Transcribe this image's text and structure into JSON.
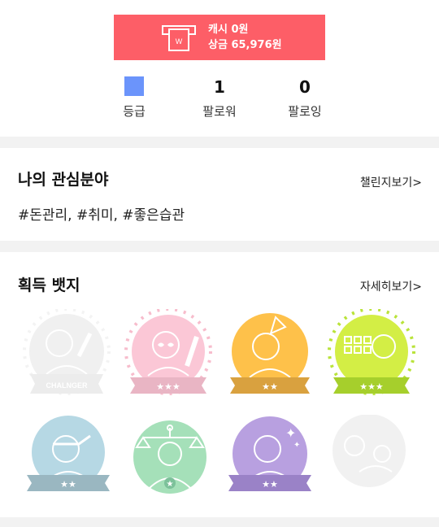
{
  "cash": {
    "cash_text": "캐시 0원",
    "prize_text": "상금 65,976원",
    "icon": "wallet-icon",
    "color": "#fd5e67"
  },
  "stats": {
    "grade": {
      "label": "등급",
      "color": "#6b94fb"
    },
    "followers": {
      "value": "1",
      "label": "팔로워"
    },
    "following": {
      "value": "0",
      "label": "팔로잉"
    }
  },
  "interests": {
    "title": "나의 관심분야",
    "link": "챌린지보기>",
    "tags": "#돈관리, #취미, #좋은습관"
  },
  "badges": {
    "title": "획득 뱃지",
    "link": "자세히보기>",
    "items": [
      {
        "name": "challenger-badge",
        "ribbon_text": "CHALNGER",
        "stars": 0,
        "earned": false
      },
      {
        "name": "pink-heart-glasses-badge",
        "stars": 3,
        "earned": true
      },
      {
        "name": "yellow-flag-badge",
        "stars": 2,
        "earned": true
      },
      {
        "name": "lime-checklist-badge",
        "stars": 3,
        "earned": true
      },
      {
        "name": "blue-headband-badge",
        "stars": 2,
        "earned": true
      },
      {
        "name": "green-scale-badge",
        "stars": 1,
        "earned": true
      },
      {
        "name": "purple-sparkle-badge",
        "stars": 2,
        "earned": true
      },
      {
        "name": "gray-locked-badge",
        "stars": 0,
        "earned": false
      }
    ]
  }
}
